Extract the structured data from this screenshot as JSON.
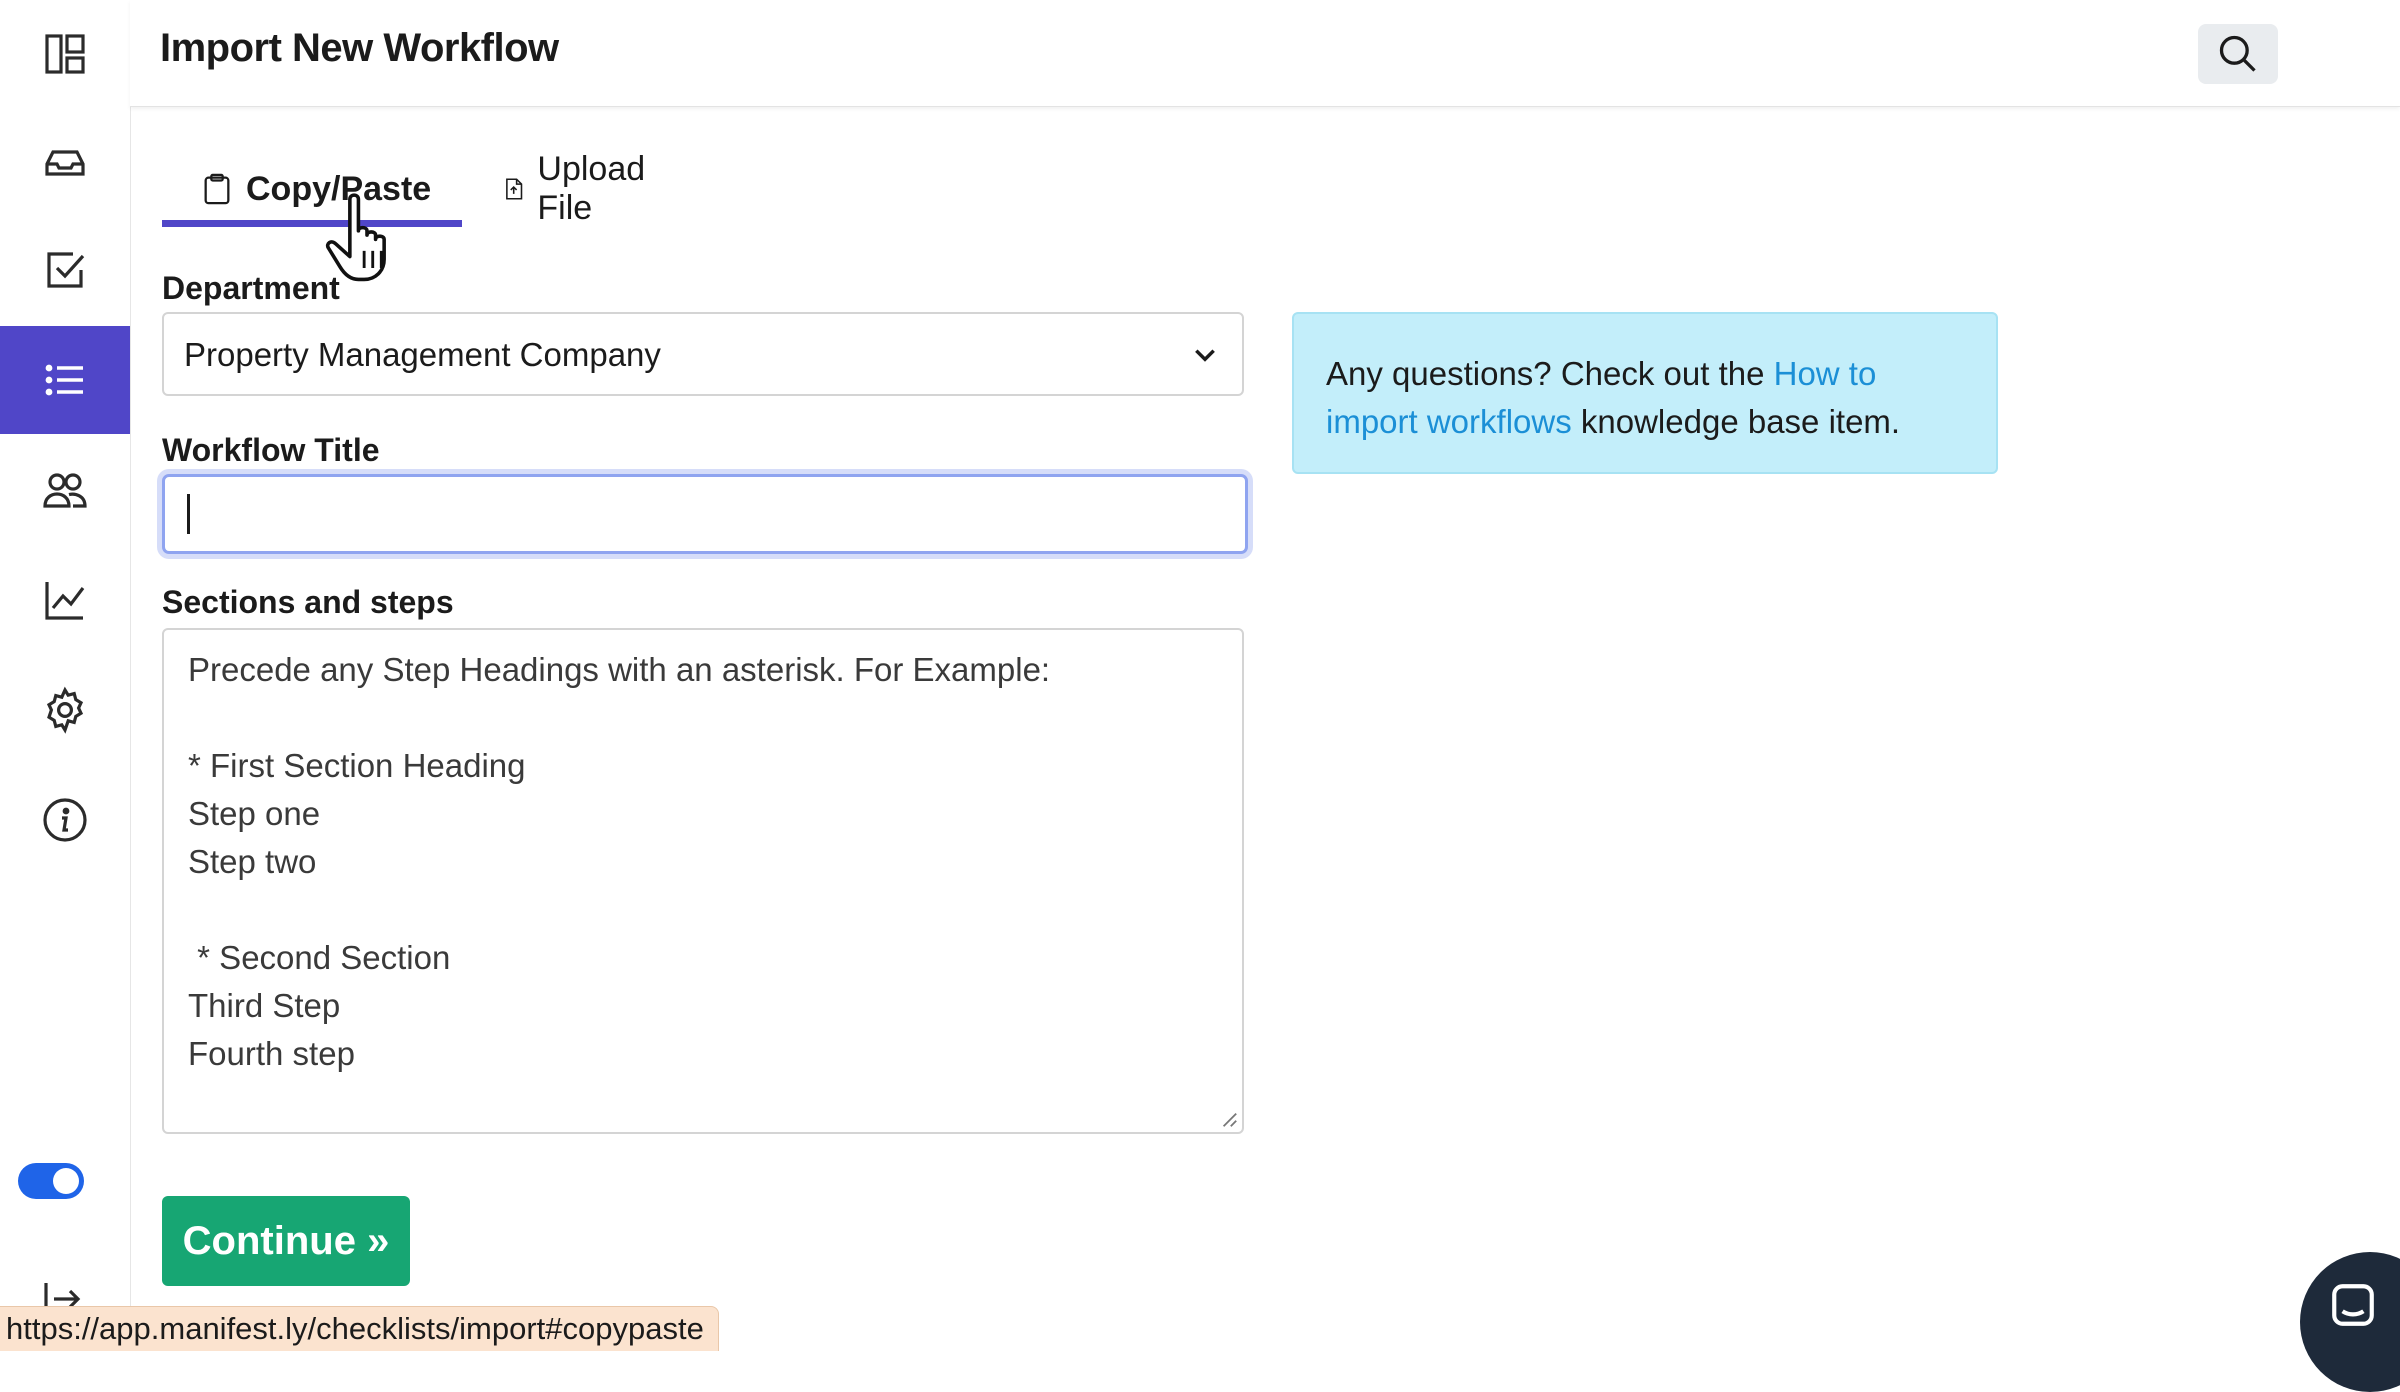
{
  "header": {
    "title": "Import New Workflow"
  },
  "sidebar": {
    "items": [
      {
        "icon": "dashboard-icon"
      },
      {
        "icon": "inbox-icon"
      },
      {
        "icon": "checkbox-icon"
      },
      {
        "icon": "list-icon",
        "active": true
      },
      {
        "icon": "users-icon"
      },
      {
        "icon": "chart-line-icon"
      },
      {
        "icon": "gear-icon"
      },
      {
        "icon": "info-icon"
      }
    ],
    "toggle_on": true
  },
  "tabs": [
    {
      "label": "Copy/Paste",
      "icon": "clipboard-icon",
      "active": true
    },
    {
      "label": "Upload File",
      "icon": "file-upload-icon",
      "active": false
    }
  ],
  "form": {
    "department_label": "Department",
    "department_value": "Property Management Company",
    "title_label": "Workflow Title",
    "title_value": "",
    "sections_label": "Sections and steps",
    "sections_placeholder": "Precede any Step Headings with an asterisk. For Example:\n\n* First Section Heading\nStep one\nStep two\n\n * Second Section\nThird Step\nFourth step",
    "continue_label": "Continue »"
  },
  "info": {
    "prefix": "Any questions? Check out the ",
    "link_text": "How to import workflows",
    "suffix": " knowledge base item."
  },
  "status_bar": {
    "url": "https://app.manifest.ly/checklists/import#copypaste"
  },
  "colors": {
    "accent": "#5046c8",
    "continue_button": "#17a673",
    "info_background": "#c3eefa",
    "link": "#1b8fd6",
    "toggle": "#1f64e8"
  }
}
